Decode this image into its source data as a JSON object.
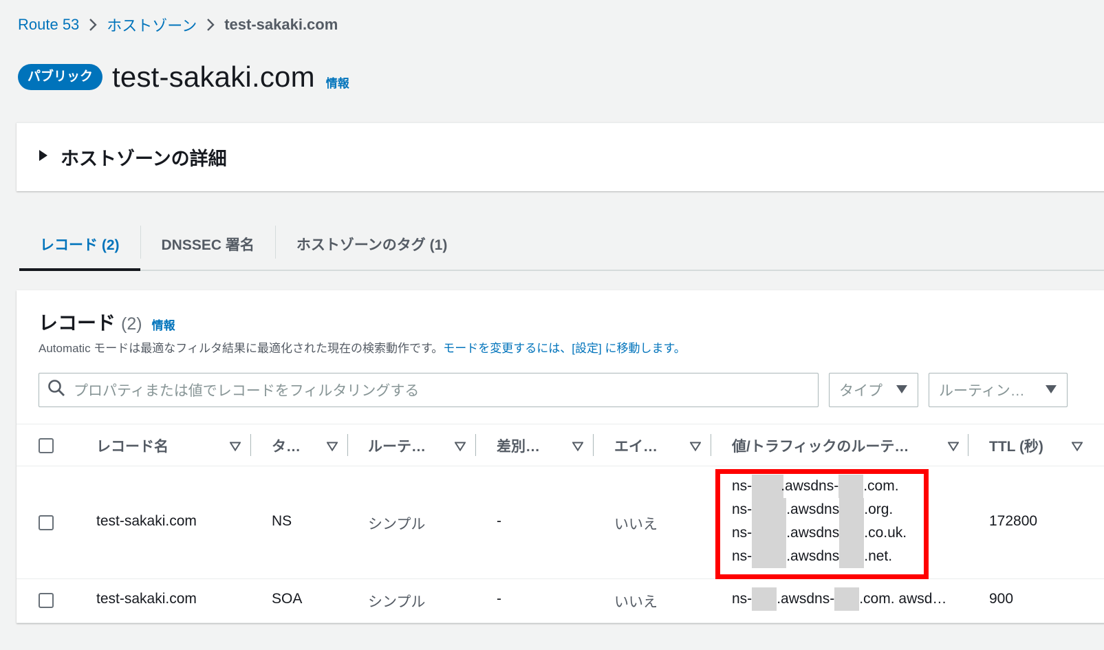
{
  "breadcrumb": {
    "items": [
      "Route 53",
      "ホストゾーン"
    ],
    "current": "test-sakaki.com"
  },
  "header": {
    "badge": "パブリック",
    "title": "test-sakaki.com",
    "info": "情報"
  },
  "details_panel": {
    "label": "ホストゾーンの詳細"
  },
  "tabs": [
    {
      "label": "レコード (2)",
      "active": true
    },
    {
      "label": "DNSSEC 署名",
      "active": false
    },
    {
      "label": "ホストゾーンのタグ (1)",
      "active": false
    }
  ],
  "records": {
    "heading": "レコード",
    "count": "(2)",
    "info": "情報",
    "desc_text": "Automatic モードは最適なフィルタ結果に最適化された現在の検索動作です。",
    "desc_link": "モードを変更するには、[設定] に移動します。",
    "search_placeholder": "プロパティまたは値でレコードをフィルタリングする",
    "filter_type": "タイプ",
    "filter_routing": "ルーティン…",
    "columns": [
      "レコード名",
      "タ…",
      "ルーテ…",
      "差別…",
      "エイ…",
      "値/トラフィックのルーテ…",
      "TTL (秒)"
    ],
    "rows": [
      {
        "name": "test-sakaki.com",
        "type": "NS",
        "routing": "シンプル",
        "diff": "-",
        "alias": "いいえ",
        "values": [
          [
            "ns-",
            ".awsdns-",
            ".com."
          ],
          [
            "ns-",
            ".awsdns",
            ".org."
          ],
          [
            "ns-",
            ".awsdns",
            ".co.uk."
          ],
          [
            "ns-",
            ".awsdns",
            ".net."
          ]
        ],
        "ttl": "172800"
      },
      {
        "name": "test-sakaki.com",
        "type": "SOA",
        "routing": "シンプル",
        "diff": "-",
        "alias": "いいえ",
        "value_parts": [
          "ns-",
          ".awsdns-",
          ".com. awsd…"
        ],
        "ttl": "900"
      }
    ]
  },
  "colors": {
    "link": "#0073bb",
    "highlight": "#ff0000",
    "badge": "#0073bb"
  }
}
